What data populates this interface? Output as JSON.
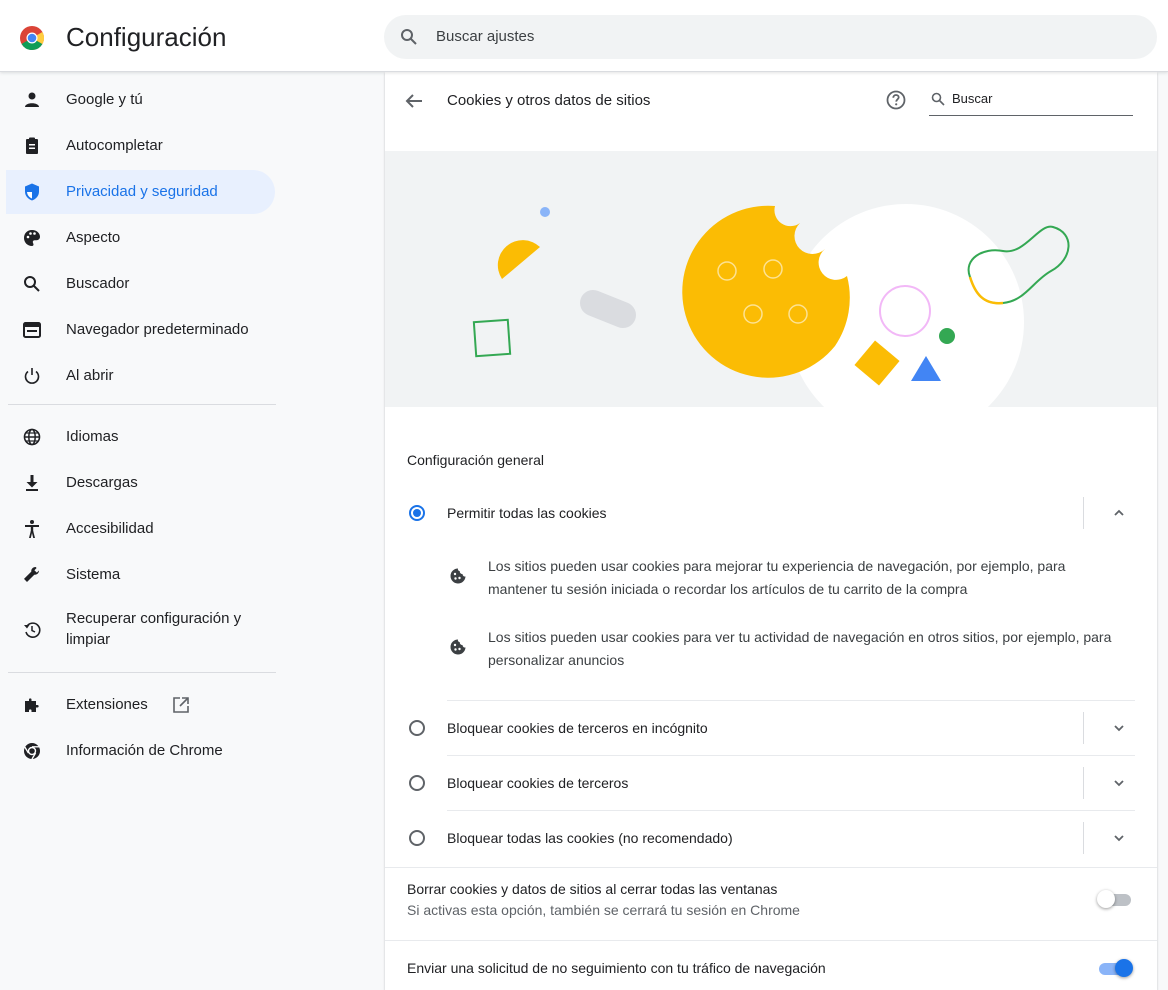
{
  "app": {
    "title": "Configuración"
  },
  "search": {
    "placeholder": "Buscar ajustes"
  },
  "sidebar": {
    "items": [
      {
        "label": "Google y tú",
        "icon": "person-icon"
      },
      {
        "label": "Autocompletar",
        "icon": "clipboard-icon"
      },
      {
        "label": "Privacidad y seguridad",
        "icon": "shield-icon",
        "active": true
      },
      {
        "label": "Aspecto",
        "icon": "palette-icon"
      },
      {
        "label": "Buscador",
        "icon": "search-icon"
      },
      {
        "label": "Navegador predeterminado",
        "icon": "browser-icon"
      },
      {
        "label": "Al abrir",
        "icon": "power-icon"
      },
      {
        "label": "Idiomas",
        "icon": "globe-icon"
      },
      {
        "label": "Descargas",
        "icon": "download-icon"
      },
      {
        "label": "Accesibilidad",
        "icon": "accessibility-icon"
      },
      {
        "label": "Sistema",
        "icon": "wrench-icon"
      },
      {
        "label": "Recuperar configuración y limpiar",
        "icon": "restore-icon"
      },
      {
        "label": "Extensiones",
        "icon": "puzzle-icon"
      },
      {
        "label": "Información de Chrome",
        "icon": "chrome-icon"
      }
    ]
  },
  "page": {
    "title": "Cookies y otros datos de sitios",
    "search_placeholder": "Buscar",
    "section_title": "Configuración general",
    "options": [
      {
        "label": "Permitir todas las cookies",
        "selected": true,
        "expanded": true
      },
      {
        "label": "Bloquear cookies de terceros en incógnito",
        "selected": false
      },
      {
        "label": "Bloquear cookies de terceros",
        "selected": false
      },
      {
        "label": "Bloquear todas las cookies (no recomendado)",
        "selected": false
      }
    ],
    "details": [
      "Los sitios pueden usar cookies para mejorar tu experiencia de navegación, por ejemplo, para mantener tu sesión iniciada o recordar los artículos de tu carrito de la compra",
      "Los sitios pueden usar cookies para ver tu actividad de navegación en otros sitios, por ejemplo, para personalizar anuncios"
    ],
    "toggles": [
      {
        "label": "Borrar cookies y datos de sitios al cerrar todas las ventanas",
        "sublabel": "Si activas esta opción, también se cerrará tu sesión en Chrome",
        "on": false
      },
      {
        "label": "Enviar una solicitud de no seguimiento con tu tráfico de navegación",
        "on": true
      }
    ]
  },
  "colors": {
    "accent": "#1a73e8",
    "active_bg": "#e8f0fe",
    "cookie": "#fbbc04",
    "green": "#34a853",
    "blue": "#4285f4"
  }
}
